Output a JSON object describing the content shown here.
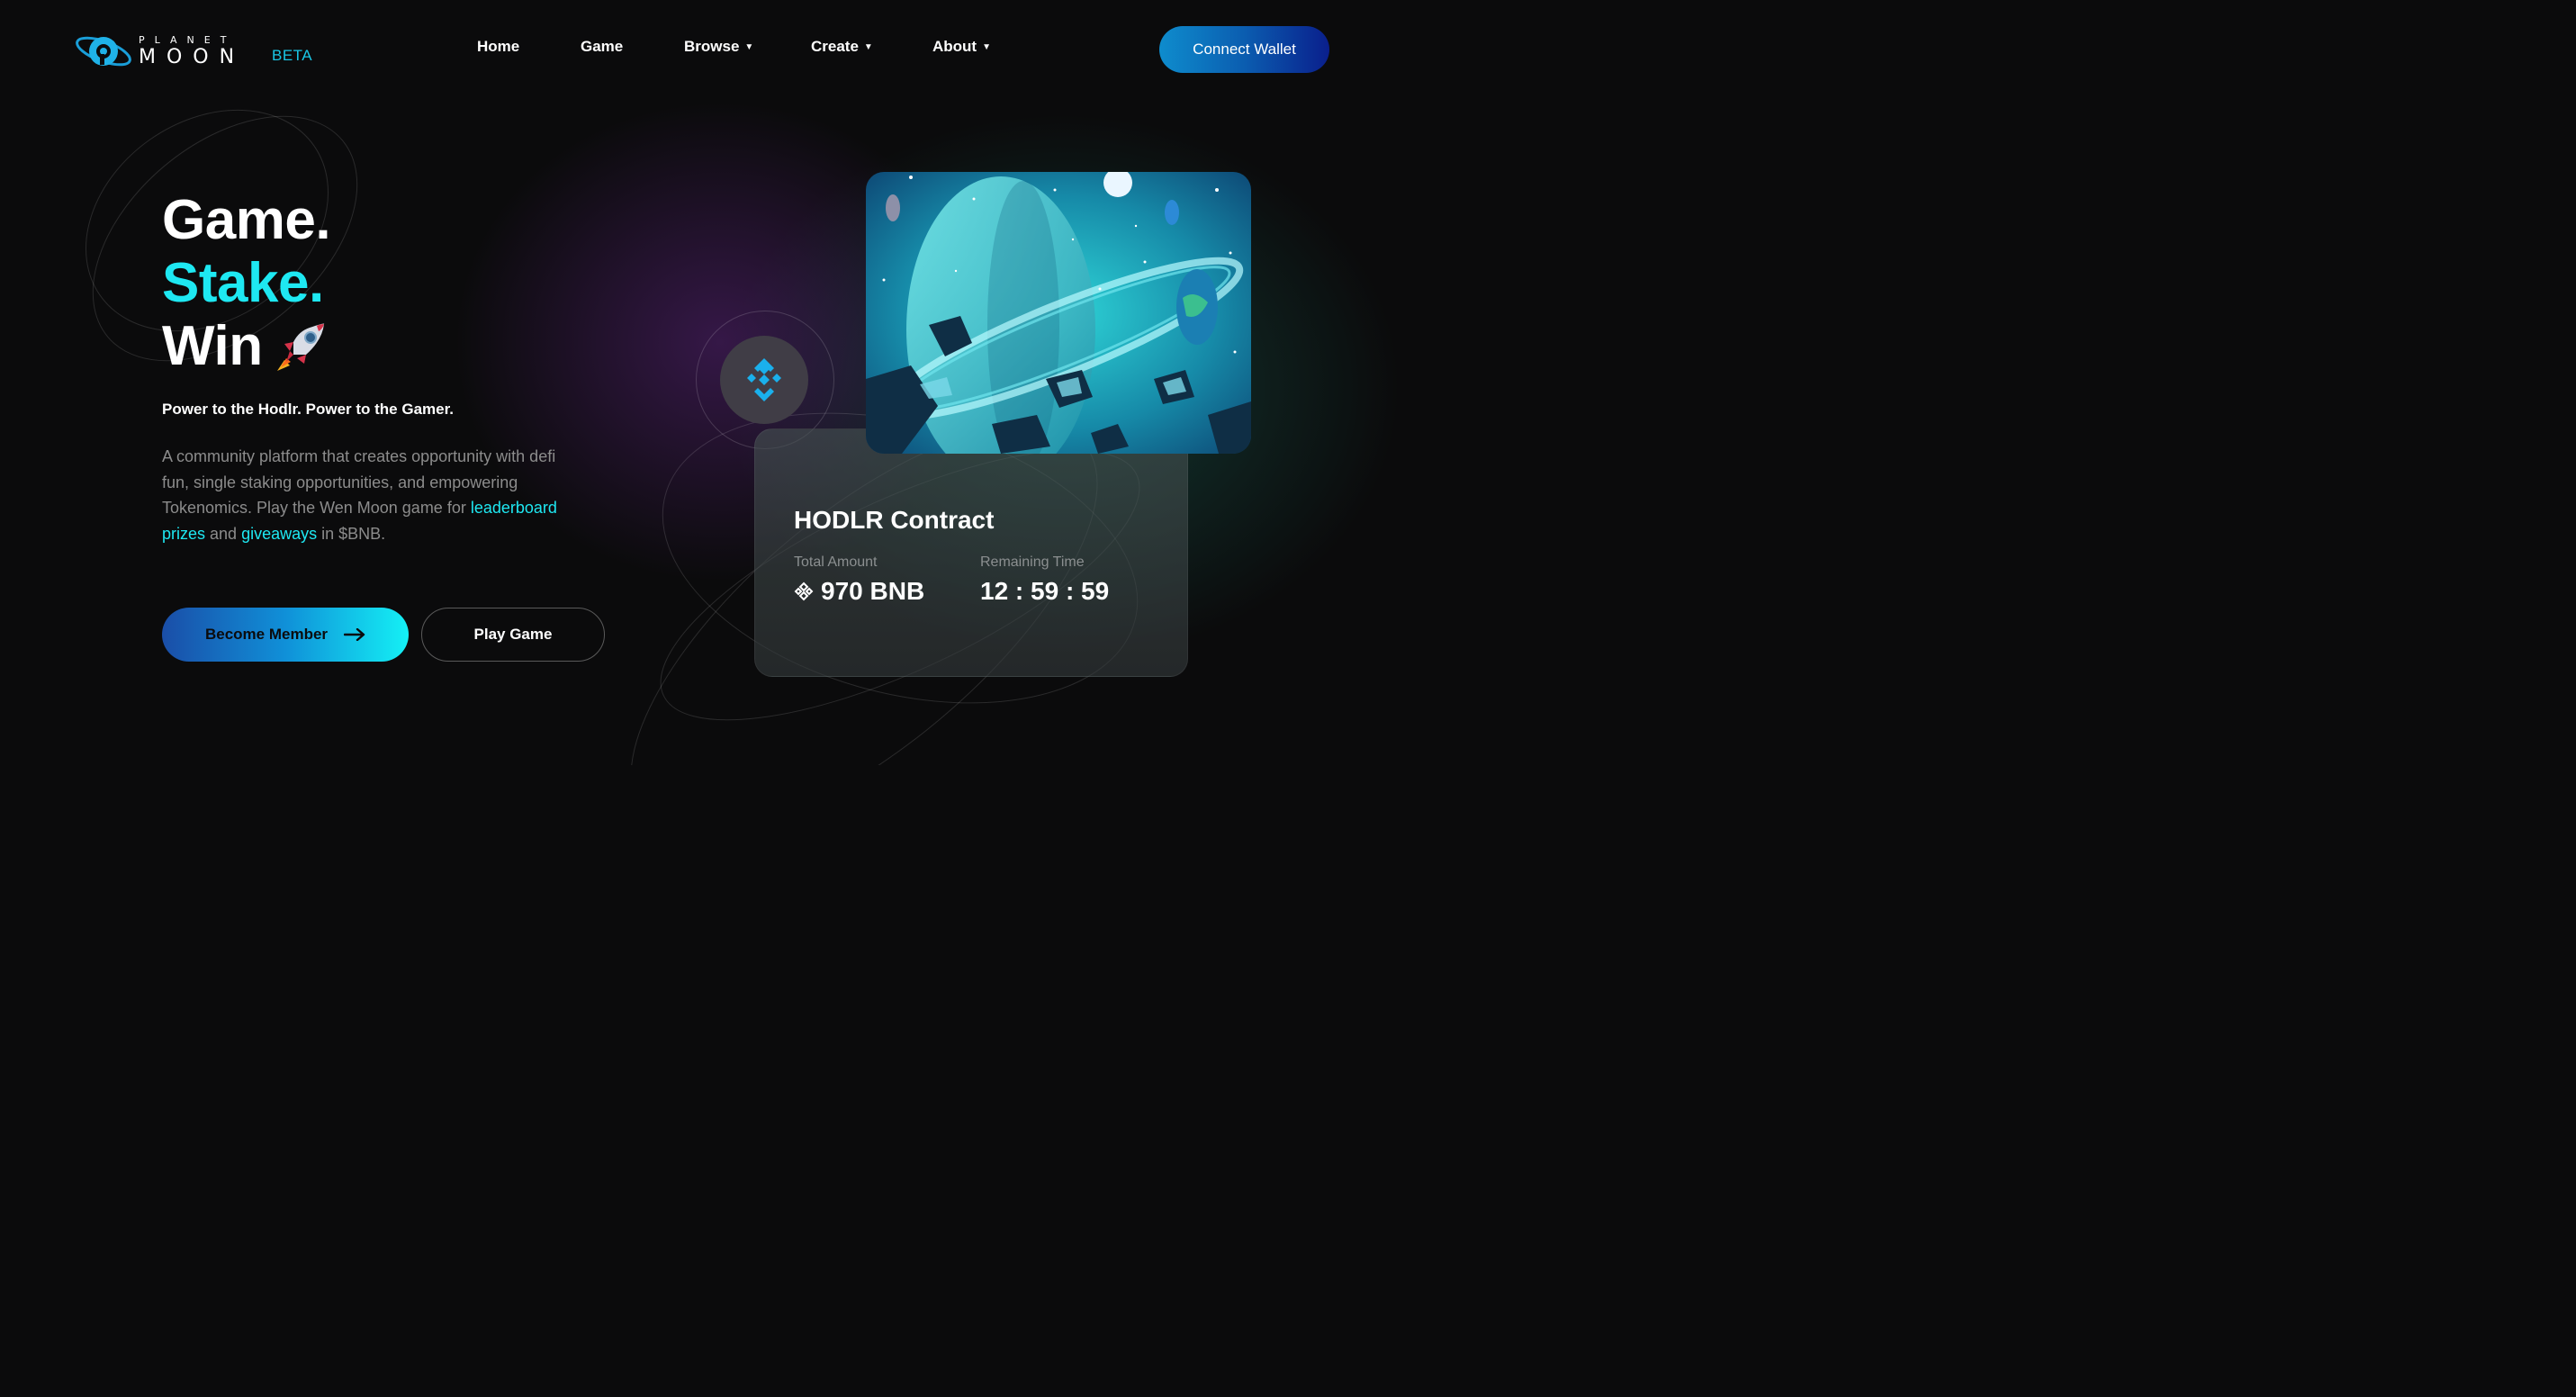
{
  "brand": {
    "logo_word_top": "PLANET",
    "logo_word_bottom": "MOON",
    "beta": "BETA",
    "accent_cyan": "#1ee8f2",
    "accent_blue": "#0e8ccd"
  },
  "nav": {
    "items": [
      {
        "label": "Home",
        "has_dropdown": false
      },
      {
        "label": "Game",
        "has_dropdown": false
      },
      {
        "label": "Browse",
        "has_dropdown": true
      },
      {
        "label": "Create",
        "has_dropdown": true
      },
      {
        "label": "About",
        "has_dropdown": true
      }
    ],
    "dropdown_icon": "caret-down-icon",
    "connect_label": "Connect Wallet"
  },
  "hero": {
    "line1": "Game.",
    "line2": "Stake.",
    "line3": "Win",
    "line3_icon": "rocket-icon",
    "tagline": "Power to the Hodlr. Power to the Gamer.",
    "desc_part1": "A community platform that creates opportunity with defi fun, single staking opportunities, and empowering Tokenomics. Play the Wen Moon game for ",
    "desc_link1": "leaderboard prizes",
    "desc_part2": " and ",
    "desc_link2": "giveaways",
    "desc_part3": " in $BNB.",
    "primary_button": "Become Member",
    "primary_button_icon": "arrow-right-icon",
    "secondary_button": "Play Game"
  },
  "contract": {
    "badge_icon": "bnb-icon",
    "image_icon": "planet-space-illustration",
    "title": "HODLR Contract",
    "total_label": "Total Amount",
    "total_value": "970 BNB",
    "remaining_label": "Remaining Time",
    "remaining_value": "12 : 59 : 59"
  }
}
